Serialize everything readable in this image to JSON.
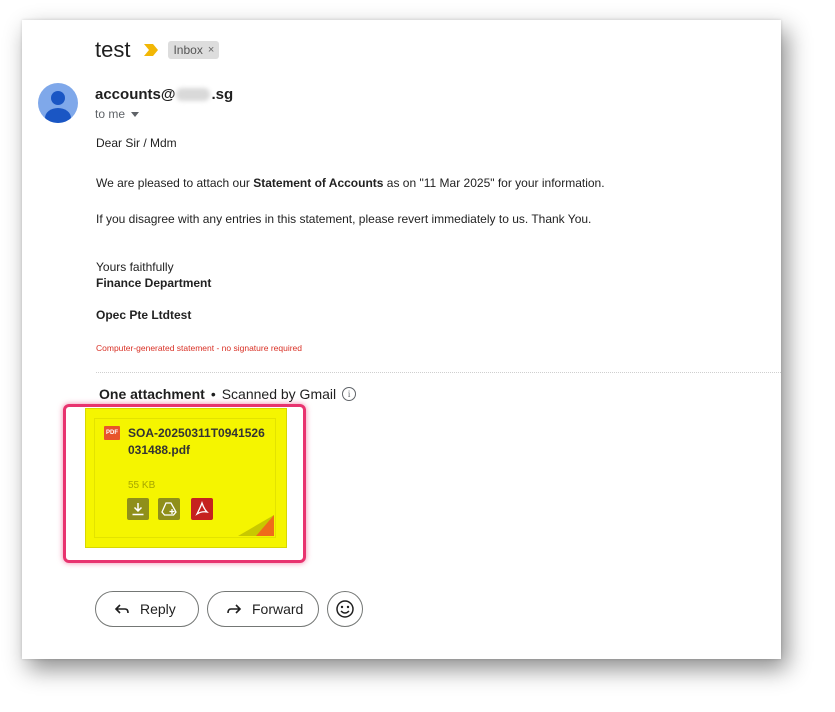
{
  "subject": "test",
  "label": {
    "text": "Inbox",
    "remove": "×"
  },
  "sender": {
    "prefix": "accounts@",
    "suffix": ".sg"
  },
  "recipient": "to me",
  "body": {
    "greeting": "Dear Sir / Mdm",
    "line1_pre": "We are pleased to attach our ",
    "line1_bold": "Statement of Accounts",
    "line1_post": " as on \"11 Mar 2025\" for your information.",
    "line2": "If you disagree with any entries in this statement, please revert immediately to us. Thank You.",
    "closing": "Yours faithfully",
    "department": "Finance Department",
    "company": "Opec Pte Ltdtest",
    "note": "Computer-generated statement - no signature required"
  },
  "attachments": {
    "heading": "One attachment",
    "separator": "•",
    "scanned": "Scanned by Gmail",
    "file": {
      "type_badge": "PDF",
      "name": "SOA-20250311T0941526031488.pdf",
      "size": "55 KB"
    }
  },
  "actions": {
    "reply": "Reply",
    "forward": "Forward"
  },
  "colors": {
    "highlight": "#f5f500",
    "annotation_border": "#e8336f",
    "pdf_red": "#c5221f",
    "note_red": "#d93025"
  }
}
